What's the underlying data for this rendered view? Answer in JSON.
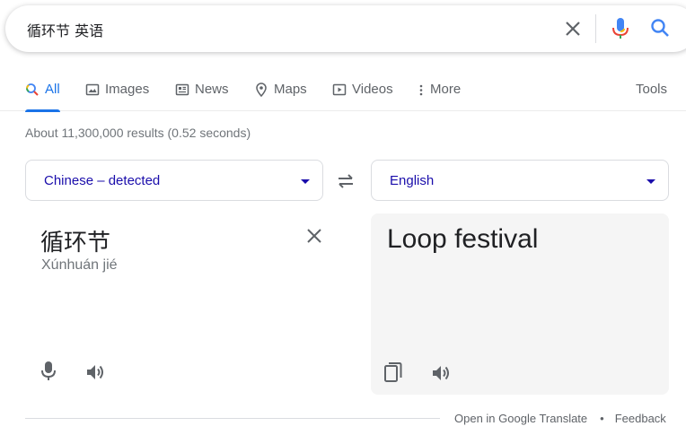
{
  "search": {
    "query": "循环节 英语"
  },
  "tabs": [
    {
      "label": "All",
      "icon": "search-icon"
    },
    {
      "label": "Images",
      "icon": "image-icon"
    },
    {
      "label": "News",
      "icon": "news-icon"
    },
    {
      "label": "Maps",
      "icon": "map-pin-icon"
    },
    {
      "label": "Videos",
      "icon": "video-icon"
    },
    {
      "label": "More",
      "icon": "more-vert-icon"
    }
  ],
  "tools_label": "Tools",
  "stats": "About 11,300,000 results (0.52 seconds)",
  "translator": {
    "source_lang": "Chinese – detected",
    "target_lang": "English",
    "source_text": "循环节",
    "pinyin": "Xúnhuán jié",
    "target_text": "Loop festival"
  },
  "footer": {
    "open_link": "Open in Google Translate",
    "separator": "•",
    "feedback": "Feedback"
  },
  "colors": {
    "accent": "#1a73e8",
    "link": "#1a0dab",
    "muted": "#70757a",
    "panel_bg": "#f5f5f5"
  }
}
